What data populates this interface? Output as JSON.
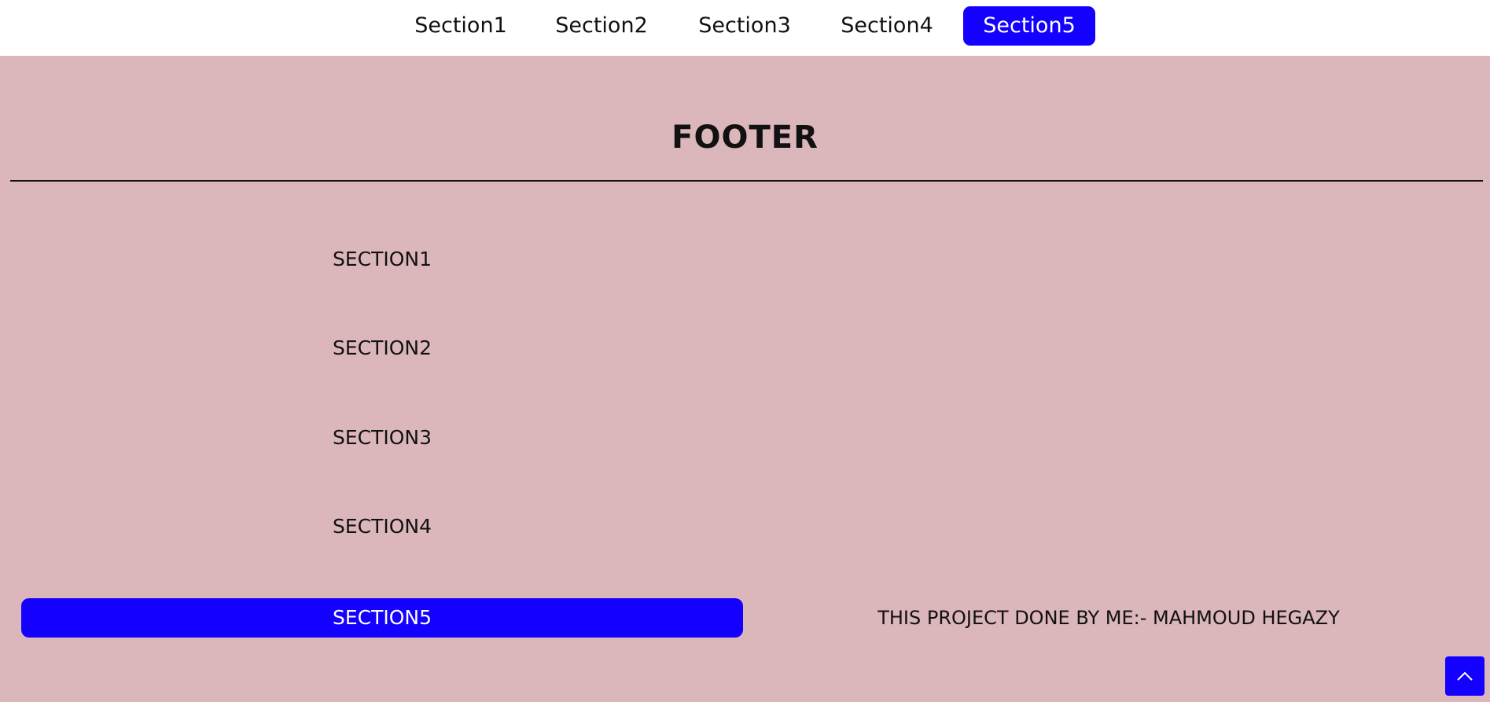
{
  "nav": {
    "items": [
      {
        "label": "Section1"
      },
      {
        "label": "Section2"
      },
      {
        "label": "Section3"
      },
      {
        "label": "Section4"
      },
      {
        "label": "Section5",
        "active": true
      }
    ]
  },
  "footer": {
    "title": "FOOTER",
    "links": [
      {
        "label": "SECTION1"
      },
      {
        "label": "SECTION2"
      },
      {
        "label": "SECTION3"
      },
      {
        "label": "SECTION4"
      },
      {
        "label": "SECTION5",
        "active": true
      }
    ],
    "credit": "THIS PROJECT DONE BY ME:- MAHMOUD HEGAZY"
  },
  "scroll_top": {
    "icon": "chevron-up-icon"
  },
  "colors": {
    "background": "#dbb6bb",
    "navbar": "#ffffff",
    "accent": "#1400ff",
    "text": "#111111"
  }
}
